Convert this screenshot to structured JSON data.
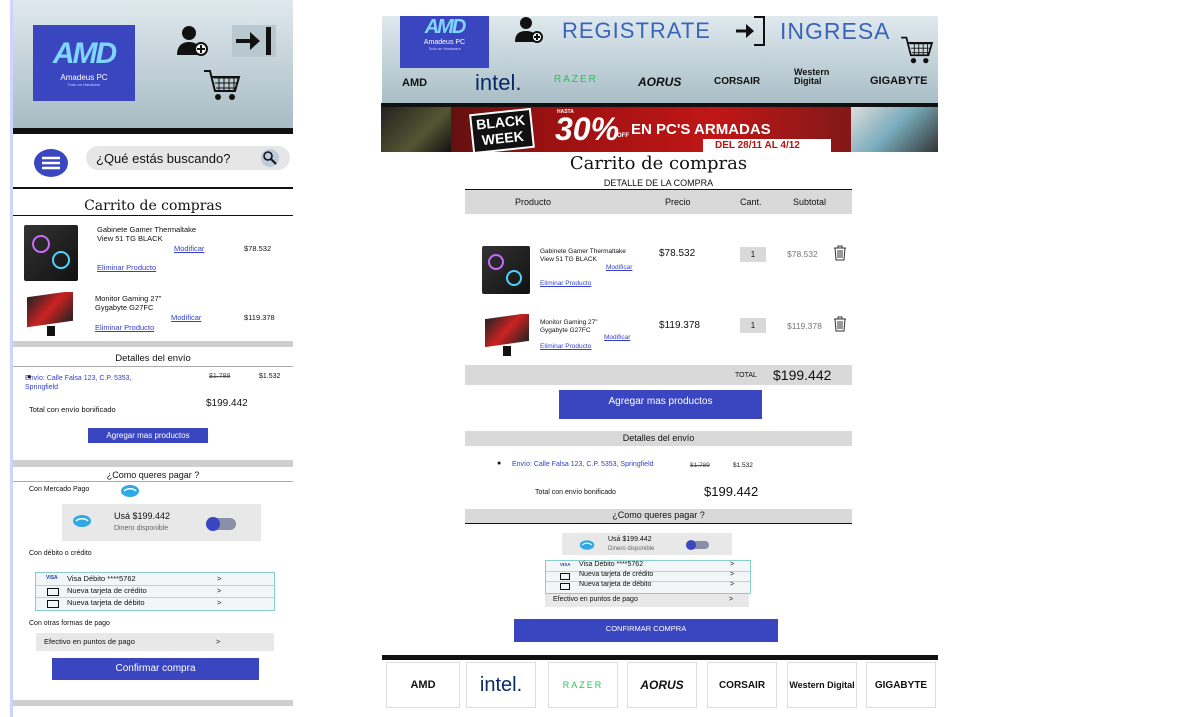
{
  "mobile": {
    "logo": {
      "mark": "AMD",
      "name": "Amadeus PC",
      "tagline": "Todo en Hardware"
    },
    "search_placeholder": "¿Qué estás buscando?",
    "cart_title": "Carrito de compras",
    "items": [
      {
        "name": "Gabinete Gamer Thermaltake View 51 TG BLACK",
        "modify": "Modificar",
        "remove": "Eliminar Producto",
        "price": "$78.532"
      },
      {
        "name": "Monitor Gaming 27\" Gygabyte G27FC",
        "modify": "Modificar",
        "remove": "Eliminar Producto",
        "price": "$119.378"
      }
    ],
    "shipping_title": "Detalles del envío",
    "shipping_address": "Envío: Calle Falsa 123, C.P. 5353, Springfield",
    "shipping_old": "$1.789",
    "shipping_new": "$1.532",
    "total_label": "Total con envío bonificado",
    "total_value": "$199.442",
    "add_more": "Agregar mas productos",
    "pay_title": "¿Como queres pagar ?",
    "mp_label": "Con Mercado Pago",
    "mp_use": "Usá $199.442",
    "mp_available": "Dinero disponible",
    "card_label": "Con débito o crédito",
    "cards": [
      {
        "label": "Visa Débito ****5762",
        "arrow": ">"
      },
      {
        "label": "Nueva tarjeta de crédito",
        "arrow": ">"
      },
      {
        "label": "Nueva tarjeta de débito",
        "arrow": ">"
      }
    ],
    "other_label": "Con otras formas de pago",
    "cash": {
      "label": "Efectivo en puntos de pago",
      "arrow": ">"
    },
    "confirm": "Confirmar compra"
  },
  "desktop": {
    "logo": {
      "mark": "AMD",
      "name": "Amadeus PC",
      "tagline": "Todo en Hardware"
    },
    "register": "REGISTRATE",
    "login": "INGRESA",
    "brands": [
      "AMD",
      "intel.",
      "RAZER",
      "AORUS",
      "CORSAIR",
      "Western Digital",
      "GIGABYTE"
    ],
    "banner": {
      "line1": "BLACK",
      "line2": "WEEK",
      "hasta": "HASTA",
      "pct": "30%",
      "off": "OFF",
      "text": "EN PC'S ARMADAS",
      "dates": "DEL 28/11 AL 4/12"
    },
    "cart_title": "Carrito de compras",
    "detail_title": "DETALLE DE LA COMPRA",
    "columns": [
      "Producto",
      "Precio",
      "Cant.",
      "Subtotal"
    ],
    "items": [
      {
        "name": "Gabinete Gamer Thermaltake View 51 TG BLACK",
        "modify": "Modificar",
        "remove": "Eliminar Producto",
        "price": "$78.532",
        "qty": "1",
        "subtotal": "$78.532"
      },
      {
        "name": "Monitor Gaming 27\" Gygabyte G27FC",
        "modify": "Modificar",
        "remove": "Eliminar Producto",
        "price": "$119.378",
        "qty": "1",
        "subtotal": "$119.378"
      }
    ],
    "total_label": "TOTAL",
    "total_value": "$199.442",
    "add_more": "Agregar mas productos",
    "shipping_title": "Detalles del envío",
    "shipping_address": "Envío: Calle Falsa 123, C.P. 5353, Springfield",
    "shipping_old": "$1.789",
    "shipping_new": "$1.532",
    "shipping_total_label": "Total con envío bonificado",
    "shipping_total_value": "$199.442",
    "pay_title": "¿Como queres pagar ?",
    "mp_use": "Usá $199.442",
    "mp_available": "Dinero disponible",
    "cards": [
      {
        "label": "Visa Débito ****5762",
        "arrow": ">"
      },
      {
        "label": "Nueva tarjeta de crédito",
        "arrow": ">"
      },
      {
        "label": "Nueva tarjeta de débito",
        "arrow": ">"
      }
    ],
    "cash": {
      "label": "Efectivo en puntos de pago",
      "arrow": ">"
    },
    "confirm": "CONFIRMAR COMPRA"
  },
  "colors": {
    "accent": "#3a46c0",
    "band": "#d9d9d9",
    "link": "#3440c8"
  }
}
